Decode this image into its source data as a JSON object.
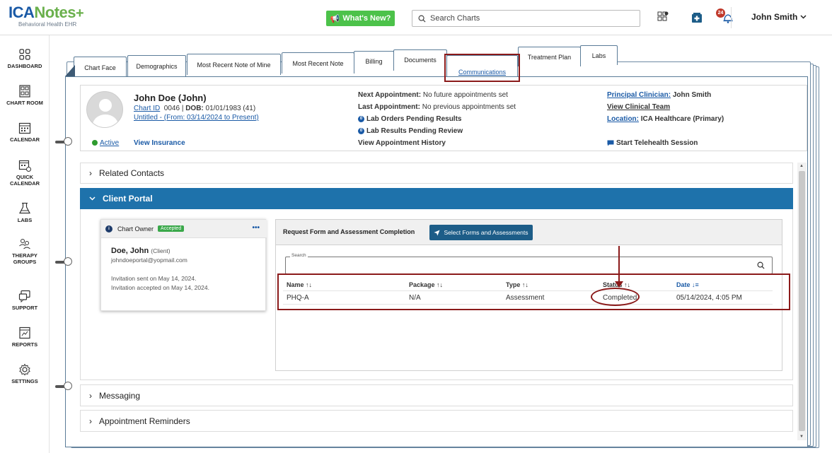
{
  "topbar": {
    "logo_main_a": "ICA",
    "logo_main_b": "Notes",
    "logo_plus": "+",
    "logo_sub": "Behavioral Health EHR",
    "whats_new": "What's New?",
    "search_placeholder": "Search Charts",
    "notification_count": "24",
    "user_name": "John Smith"
  },
  "sidebar": {
    "items": [
      {
        "label": "DASHBOARD",
        "icon": "dashboard-icon"
      },
      {
        "label": "CHART ROOM",
        "icon": "chart-room-icon"
      },
      {
        "label": "CALENDAR",
        "icon": "calendar-icon"
      },
      {
        "label": "QUICK",
        "label2": "CALENDAR",
        "icon": "quick-calendar-icon"
      },
      {
        "label": "LABS",
        "icon": "labs-icon"
      },
      {
        "label": "THERAPY",
        "label2": "GROUPS",
        "icon": "therapy-groups-icon"
      },
      {
        "label": "SUPPORT",
        "icon": "support-icon"
      },
      {
        "label": "REPORTS",
        "icon": "reports-icon"
      },
      {
        "label": "SETTINGS",
        "icon": "settings-icon"
      }
    ]
  },
  "tabs": {
    "chart_face": "Chart Face",
    "demographics": "Demographics",
    "recent_note_mine": "Most Recent Note of Mine",
    "recent_note": "Most Recent Note",
    "billing": "Billing",
    "documents": "Documents",
    "communications": "Communications",
    "treatment_plan": "Treatment Plan",
    "labs": "Labs"
  },
  "patient": {
    "name": "John Doe (John)",
    "chart_id_label": "Chart ID",
    "chart_id": "0046",
    "dob_label": "DOB:",
    "dob": "01/01/1983 (41)",
    "episode": "Untitled - (From: 03/14/2024 to Present)",
    "status": "Active",
    "view_insurance": "View Insurance",
    "next_appt_label": "Next Appointment:",
    "next_appt": "No future appointments set",
    "last_appt_label": "Last Appointment:",
    "last_appt": "No previous appointments set",
    "lab_orders": "Lab Orders Pending Results",
    "lab_results": "Lab Results Pending Review",
    "lab_count": "0",
    "view_history": "View Appointment History",
    "principal_label": "Principal Clinician:",
    "principal": "John Smith",
    "view_team": "View Clinical Team",
    "location_label": "Location:",
    "location": "ICA Healthcare (Primary)",
    "telehealth": "Start Telehealth Session"
  },
  "sections": {
    "related_contacts": "Related Contacts",
    "client_portal": "Client Portal",
    "messaging": "Messaging",
    "appointment_reminders": "Appointment Reminders"
  },
  "owner_card": {
    "title": "Chart Owner",
    "badge": "Accepted",
    "more": "•••",
    "name": "Doe, John",
    "role": "(Client)",
    "email": "johndoeportal@yopmail.com",
    "sent": "Invitation sent on May 14, 2024.",
    "accepted": "Invitation accepted on May 14, 2024."
  },
  "forms": {
    "title": "Request Form and Assessment Completion",
    "select_button": "Select Forms and Assessments",
    "search_legend": "Search",
    "columns": {
      "name": "Name ↑↓",
      "package": "Package ↑↓",
      "type": "Type ↑↓",
      "status": "Status ↑↓",
      "date": "Date ↓≡"
    },
    "rows": [
      {
        "name": "PHQ-A",
        "package": "N/A",
        "type": "Assessment",
        "status": "Completed",
        "date": "05/14/2024, 4:05 PM"
      }
    ]
  },
  "colors": {
    "accent": "#1e72ab",
    "highlight": "#8b1a1a",
    "brand_blue": "#1a5aa6",
    "brand_green": "#6ab04c"
  }
}
